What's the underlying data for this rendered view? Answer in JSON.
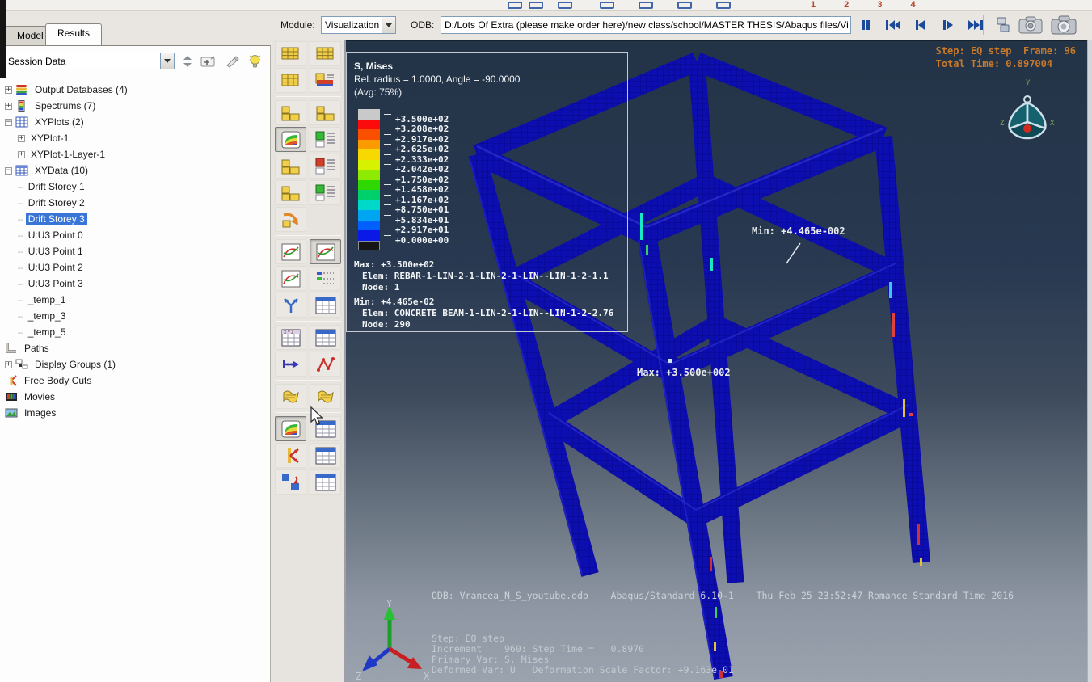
{
  "chrome": {
    "module_label": "Module:",
    "module_value": "Visualization",
    "odb_label": "ODB:",
    "odb_path": "D:/Lots Of Extra (please make order here)/new class/school/MASTER THESIS/Abaqus files/Vi",
    "top_digits": "1 2 3 4",
    "playback": [
      {
        "name": "pause-button",
        "glyph": "pause"
      },
      {
        "name": "first-frame-button",
        "glyph": "first"
      },
      {
        "name": "previous-frame-button",
        "glyph": "prev"
      },
      {
        "name": "next-frame-button",
        "glyph": "next"
      },
      {
        "name": "last-frame-button",
        "glyph": "last"
      }
    ]
  },
  "tabs": {
    "model": "Model",
    "results": "Results"
  },
  "session": {
    "combo_value": "Session Data"
  },
  "tree": [
    {
      "label": "Output Databases (4)",
      "icon": "odb",
      "expand": "plus",
      "indent": 0
    },
    {
      "label": "Spectrums (7)",
      "icon": "spectrum",
      "expand": "plus",
      "indent": 0
    },
    {
      "label": "XYPlots (2)",
      "icon": "xyplot",
      "expand": "minus",
      "indent": 0
    },
    {
      "label": "XYPlot-1",
      "icon": "none",
      "expand": "plus",
      "indent": 1
    },
    {
      "label": "XYPlot-1-Layer-1",
      "icon": "none",
      "expand": "plus",
      "indent": 1
    },
    {
      "label": "XYData (10)",
      "icon": "xydata",
      "expand": "minus",
      "indent": 0
    },
    {
      "label": "Drift Storey 1",
      "icon": "none",
      "expand": "none",
      "indent": 1
    },
    {
      "label": "Drift Storey 2",
      "icon": "none",
      "expand": "none",
      "indent": 1
    },
    {
      "label": "Drift Storey 3",
      "icon": "none",
      "expand": "none",
      "indent": 1,
      "selected": true
    },
    {
      "label": "U:U3 Point 0",
      "icon": "none",
      "expand": "none",
      "indent": 1
    },
    {
      "label": "U:U3 Point 1",
      "icon": "none",
      "expand": "none",
      "indent": 1
    },
    {
      "label": "U:U3 Point 2",
      "icon": "none",
      "expand": "none",
      "indent": 1
    },
    {
      "label": "U:U3 Point 3",
      "icon": "none",
      "expand": "none",
      "indent": 1
    },
    {
      "label": "_temp_1",
      "icon": "none",
      "expand": "none",
      "indent": 1
    },
    {
      "label": "_temp_3",
      "icon": "none",
      "expand": "none",
      "indent": 1
    },
    {
      "label": "_temp_5",
      "icon": "none",
      "expand": "none",
      "indent": 1
    },
    {
      "label": "Paths",
      "icon": "paths",
      "expand": "none",
      "indent": 0
    },
    {
      "label": "Display Groups (1)",
      "icon": "groups",
      "expand": "plus",
      "indent": 0
    },
    {
      "label": "Free Body Cuts",
      "icon": "fbc",
      "expand": "none",
      "indent": 0
    },
    {
      "label": "Movies",
      "icon": "movies",
      "expand": "none",
      "indent": 0
    },
    {
      "label": "Images",
      "icon": "images",
      "expand": "none",
      "indent": 0
    }
  ],
  "toolbox": {
    "rows": [
      [
        {
          "name": "frame-selector-icon",
          "type": "yellowgrid"
        },
        {
          "name": "grid-stack-icon",
          "type": "yellowgrid"
        }
      ],
      [
        {
          "name": "grid-frames-icon",
          "type": "yellowgrid"
        },
        {
          "name": "spectrum-list-icon",
          "type": "spectrumlist"
        }
      ],
      [
        {
          "name": "undeformed-shape-icon",
          "type": "blocks"
        },
        {
          "name": "deformed-shape-icon",
          "type": "blocks"
        }
      ],
      [
        {
          "name": "contour-plot-icon",
          "type": "rainbow",
          "pressed": true
        },
        {
          "name": "contour-options-icon",
          "type": "greenlist"
        }
      ],
      [
        {
          "name": "symbol-plot-icon",
          "type": "blocks"
        },
        {
          "name": "symbol-options-icon",
          "type": "redlist"
        }
      ],
      [
        {
          "name": "material-orientation-icon",
          "type": "blocks"
        },
        {
          "name": "orientation-options-icon",
          "type": "greenlist"
        }
      ],
      [
        {
          "name": "frame-swap-icon",
          "type": "orangearrow"
        }
      ],
      [
        {
          "name": "xy-data-create-icon",
          "type": "xyplot"
        },
        {
          "name": "xy-plot-window-icon",
          "type": "xyplot",
          "pressed": true
        }
      ],
      [
        {
          "name": "xy-curves-icon",
          "type": "xyplot"
        },
        {
          "name": "xy-list-icon",
          "type": "bluelist"
        }
      ],
      [
        {
          "name": "merge-curves-icon",
          "type": "yarrows"
        },
        {
          "name": "data-table-icon",
          "type": "bluetable"
        }
      ],
      [
        {
          "name": "xyz-table-icon",
          "type": "xyztable"
        },
        {
          "name": "table-window-icon",
          "type": "bluetable"
        }
      ],
      [
        {
          "name": "path-create-icon",
          "type": "bluearrow"
        },
        {
          "name": "zigzag-curve-icon",
          "type": "redzigzag"
        }
      ],
      [
        {
          "name": "wavy-sheet-icon",
          "type": "wavy"
        },
        {
          "name": "wavy-stack-icon",
          "type": "wavy"
        }
      ],
      [
        {
          "name": "contour-window-icon",
          "type": "rainbow",
          "pressed": true
        },
        {
          "name": "window-options-icon",
          "type": "bluetable"
        }
      ],
      [
        {
          "name": "free-body-cut-icon",
          "type": "redk"
        },
        {
          "name": "report-window-icon",
          "type": "bluetable"
        }
      ],
      [
        {
          "name": "plot-state-swap-icon",
          "type": "squaresarrow"
        },
        {
          "name": "state-table-icon",
          "type": "bluetable"
        }
      ]
    ],
    "sep_after": [
      1,
      6,
      9,
      11,
      12
    ]
  },
  "viewport": {
    "legend": {
      "title": "S, Mises",
      "subtitle": "Rel. radius = 1.0000, Angle = -90.0000",
      "avg": "(Avg: 75%)",
      "entries": [
        {
          "color": "#c9c9c9",
          "label": "+3.500e+02"
        },
        {
          "color": "#fb0b0b",
          "label": "+3.208e+02"
        },
        {
          "color": "#fb4f00",
          "label": "+2.917e+02"
        },
        {
          "color": "#fb9b00",
          "label": "+2.625e+02"
        },
        {
          "color": "#f7d800",
          "label": "+2.333e+02"
        },
        {
          "color": "#d6f200",
          "label": "+2.042e+02"
        },
        {
          "color": "#8eea00",
          "label": "+1.750e+02"
        },
        {
          "color": "#2fd800",
          "label": "+1.458e+02"
        },
        {
          "color": "#00d06c",
          "label": "+1.167e+02"
        },
        {
          "color": "#00d8c9",
          "label": "+8.750e+01"
        },
        {
          "color": "#00a5f2",
          "label": "+5.834e+01"
        },
        {
          "color": "#0060fb",
          "label": "+2.917e+01"
        },
        {
          "color": "#0a18e8",
          "label": "+0.000e+00"
        }
      ],
      "below_min_color": "#161616",
      "max_label": "Max: +3.500e+02",
      "max_elem": "Elem: REBAR-1-LIN-2-1-LIN-2-1-LIN--LIN-1-2-1.1",
      "max_node": "Node: 1",
      "min_label": "Min: +4.465e-02",
      "min_elem": "Elem: CONCRETE BEAM-1-LIN-2-1-LIN--LIN-1-2-2.76",
      "min_node": "Node: 290"
    },
    "state_line1": "Step: EQ step  Frame: 96",
    "state_line2": "Total Time: 0.897004",
    "annotation_min": "Min: +4.465e-002",
    "annotation_max": "Max: +3.500e+002",
    "footer_odb": "ODB: Vrancea_N_S_youtube.odb    Abaqus/Standard 6.10-1    Thu Feb 25 23:52:47 Romance Standard Time 2016",
    "footer_lines": [
      "Step: EQ step",
      "Increment    960: Step Time =   0.8970",
      "Primary Var: S, Mises",
      "Deformed Var: U   Deformation Scale Factor: +9.163e-01"
    ],
    "triad": {
      "x": "X",
      "y": "Y",
      "z": "Z"
    },
    "compass": {
      "x": "X",
      "y": "Y",
      "z": "Z"
    }
  }
}
